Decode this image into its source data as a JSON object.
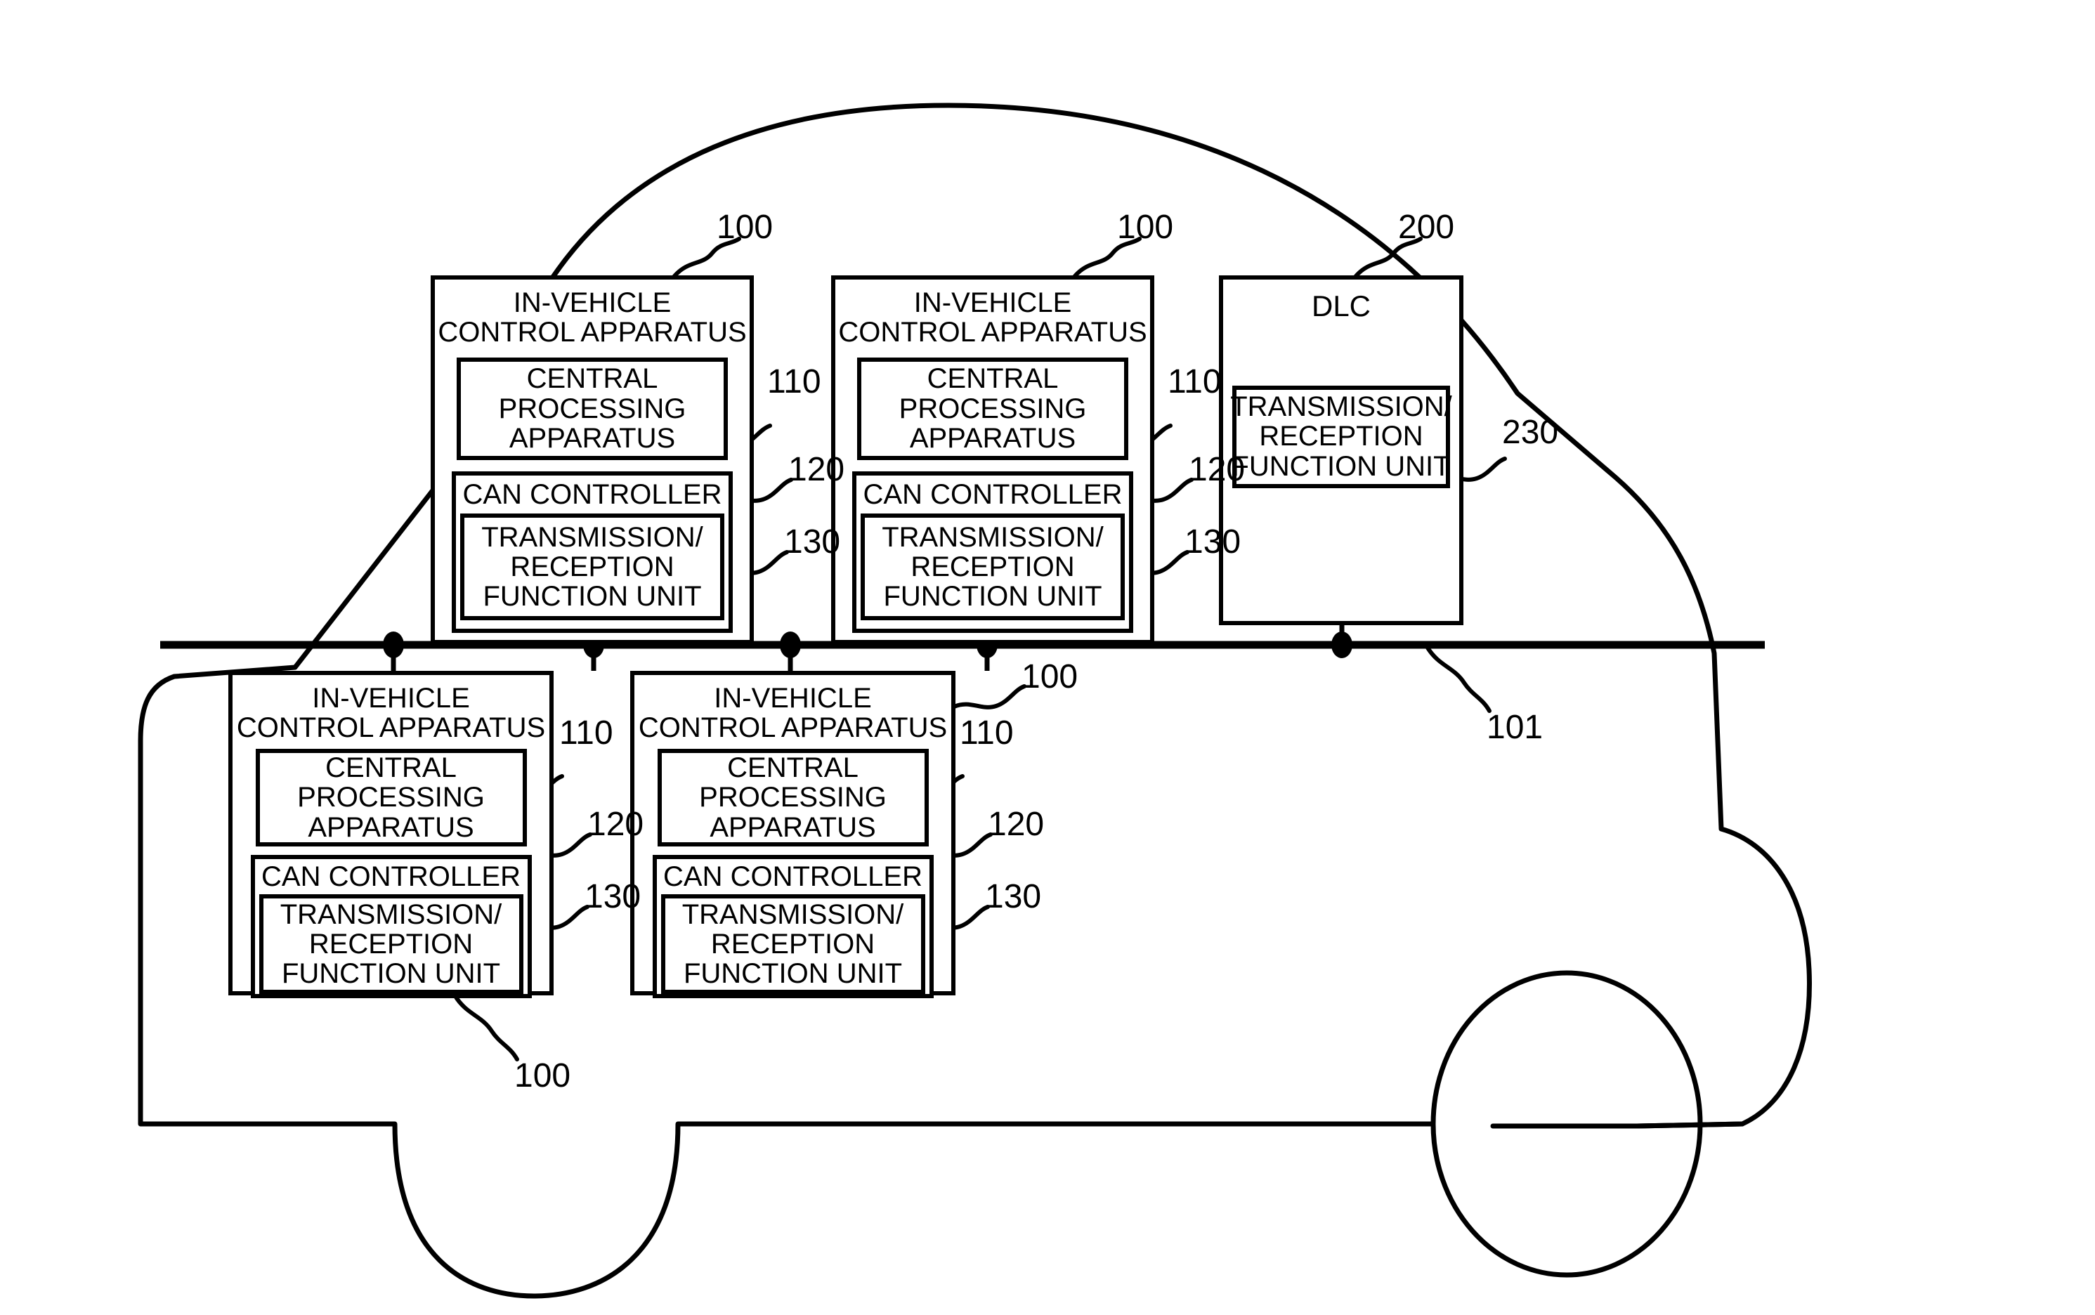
{
  "figure": {
    "type": "patent-block-diagram",
    "subject": "in-vehicle CAN network inside a vehicle silhouette",
    "background_color": "#ffffff",
    "line_color": "#000000"
  },
  "labels": {
    "in_vehicle_control_apparatus": "IN-VEHICLE\nCONTROL APPARATUS",
    "central_processing_apparatus": "CENTRAL\nPROCESSING\nAPPARATUS",
    "can_controller": "CAN CONTROLLER",
    "transmission_reception_function_unit": "TRANSMISSION/\nRECEPTION\nFUNCTION UNIT",
    "dlc": "DLC"
  },
  "reference_numerals": {
    "ecu": "100",
    "bus": "101",
    "cpu": "110",
    "can_controller": "120",
    "txrx_unit": "130",
    "dlc": "200",
    "dlc_txrx_unit": "230"
  },
  "nodes": [
    {
      "id": "ecu-top-1",
      "kind": "in-vehicle-control-apparatus",
      "position": "top-row-left",
      "title": "IN-VEHICLE\nCONTROL APPARATUS",
      "ref": "100",
      "children": [
        {
          "label": "CENTRAL\nPROCESSING\nAPPARATUS",
          "ref": "110"
        },
        {
          "label": "CAN CONTROLLER",
          "ref": "120"
        },
        {
          "label": "TRANSMISSION/\nRECEPTION\nFUNCTION UNIT",
          "ref": "130"
        }
      ]
    },
    {
      "id": "ecu-top-2",
      "kind": "in-vehicle-control-apparatus",
      "position": "top-row-middle",
      "title": "IN-VEHICLE\nCONTROL APPARATUS",
      "ref": "100",
      "children": [
        {
          "label": "CENTRAL\nPROCESSING\nAPPARATUS",
          "ref": "110"
        },
        {
          "label": "CAN CONTROLLER",
          "ref": "120"
        },
        {
          "label": "TRANSMISSION/\nRECEPTION\nFUNCTION UNIT",
          "ref": "130"
        }
      ]
    },
    {
      "id": "dlc",
      "kind": "data-link-connector",
      "position": "top-row-right",
      "title": "DLC",
      "ref": "200",
      "children": [
        {
          "label": "TRANSMISSION/\nRECEPTION\nFUNCTION UNIT",
          "ref": "230"
        }
      ]
    },
    {
      "id": "ecu-bottom-1",
      "kind": "in-vehicle-control-apparatus",
      "position": "bottom-row-left",
      "title": "IN-VEHICLE\nCONTROL APPARATUS",
      "ref": "100",
      "children": [
        {
          "label": "CENTRAL\nPROCESSING\nAPPARATUS",
          "ref": "110"
        },
        {
          "label": "CAN CONTROLLER",
          "ref": "120"
        },
        {
          "label": "TRANSMISSION/\nRECEPTION\nFUNCTION UNIT",
          "ref": "130"
        }
      ]
    },
    {
      "id": "ecu-bottom-2",
      "kind": "in-vehicle-control-apparatus",
      "position": "bottom-row-right",
      "title": "IN-VEHICLE\nCONTROL APPARATUS",
      "ref": "100",
      "children": [
        {
          "label": "CENTRAL\nPROCESSING\nAPPARATUS",
          "ref": "110"
        },
        {
          "label": "CAN CONTROLLER",
          "ref": "120"
        },
        {
          "label": "TRANSMISSION/\nRECEPTION\nFUNCTION UNIT",
          "ref": "130"
        }
      ]
    }
  ],
  "bus": {
    "ref": "101",
    "node_count": 5,
    "description": "horizontal CAN bus line with five junction dots"
  }
}
